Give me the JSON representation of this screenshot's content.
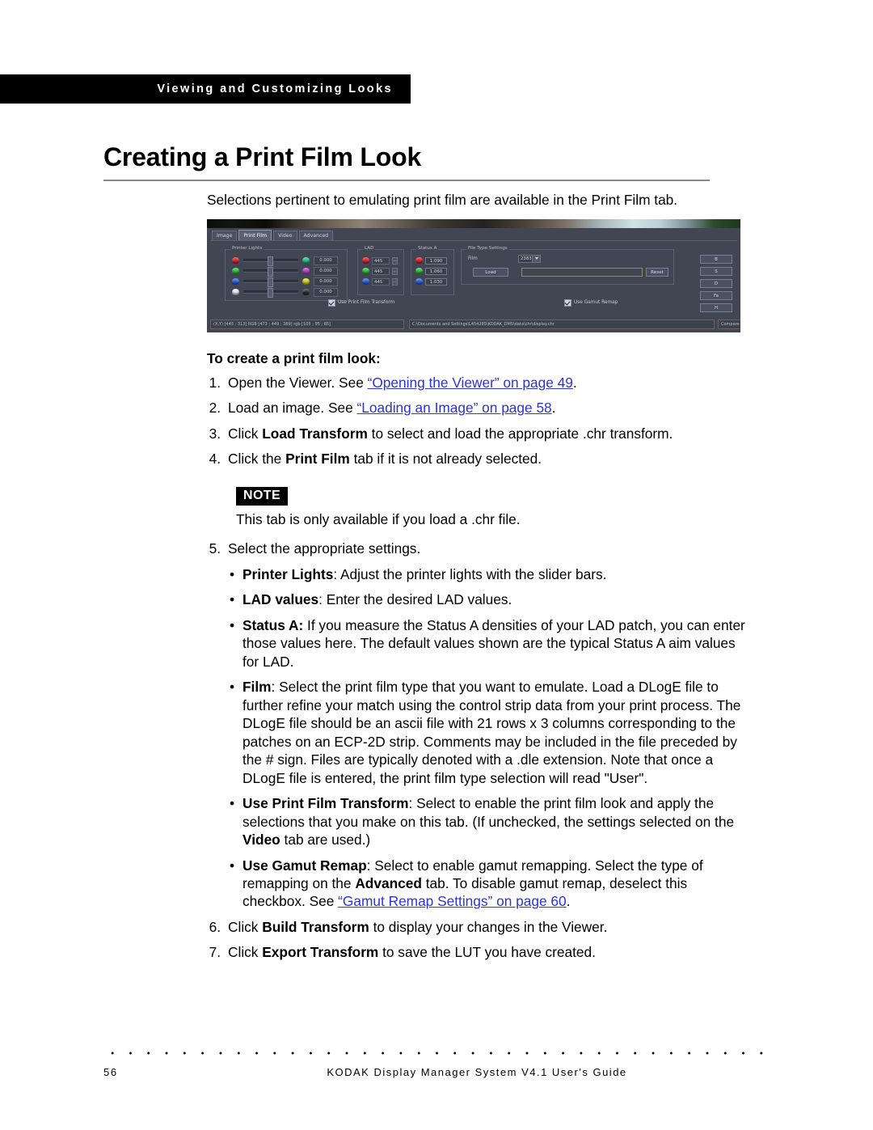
{
  "running_header": "Viewing and Customizing Looks",
  "page_title": "Creating a Print Film Look",
  "intro_paragraph": "Selections pertinent to emulating print film are available in the Print Film tab.",
  "screenshot": {
    "tabs": [
      {
        "label": "Image",
        "active": false
      },
      {
        "label": "Print Film",
        "active": true
      },
      {
        "label": "Video",
        "active": false
      },
      {
        "label": "Advanced",
        "active": false
      }
    ],
    "printer_lights": {
      "group_label": "Printer Lights",
      "rows": [
        {
          "left_color": "#e0202c",
          "right_color": "#25c28a",
          "value": "0.000",
          "thumb_pct": 44
        },
        {
          "left_color": "#2bc43a",
          "right_color": "#b53fd8",
          "value": "0.000",
          "thumb_pct": 44
        },
        {
          "left_color": "#2b5fe0",
          "right_color": "#d8d028",
          "value": "0.000",
          "thumb_pct": 44
        },
        {
          "left_color": "#e8eaf0",
          "right_color": "#2a2e36",
          "value": "0.000",
          "thumb_pct": 44
        }
      ]
    },
    "lad": {
      "group_label": "LAD",
      "rows": [
        {
          "color": "#e0202c",
          "value": "445"
        },
        {
          "color": "#2bc43a",
          "value": "445"
        },
        {
          "color": "#2b5fe0",
          "value": "445"
        }
      ]
    },
    "status_a": {
      "group_label": "Status A",
      "rows": [
        {
          "color": "#e0202c",
          "value": "1.090"
        },
        {
          "color": "#2bc43a",
          "value": "1.060"
        },
        {
          "color": "#2b5fe0",
          "value": "1.030"
        }
      ]
    },
    "film_type_settings": {
      "group_label": "File Type Settings",
      "film_label": "Film",
      "film_value": "2383",
      "load_button": "Load",
      "path_value": "",
      "reset_button": "Reset"
    },
    "checkboxes": [
      {
        "label": "Use Print Film Transform",
        "checked": true
      },
      {
        "label": "Use Gamut Remap",
        "checked": true
      }
    ],
    "right_buttons": [
      "B",
      "S",
      "D",
      "Fa",
      "H"
    ],
    "status_bar": {
      "coords": "(X,Y) [445 ; 313]  RGB [473 ; 449 ; 389]  rgb [105 ; 95 ; 85]",
      "path": "C:\\Documents and Settings\\L454285\\KODAK_DMS\\data\\chr\\display.chr",
      "compare": "Compare"
    }
  },
  "procedure": {
    "heading": "To create a print film look:",
    "steps": [
      {
        "num": "1.",
        "parts": [
          {
            "t": "Open the Viewer. See "
          },
          {
            "t": "“Opening the Viewer” on page 49",
            "style": "link"
          },
          {
            "t": "."
          }
        ]
      },
      {
        "num": "2.",
        "parts": [
          {
            "t": "Load an image. See "
          },
          {
            "t": "“Loading an Image” on page 58",
            "style": "link"
          },
          {
            "t": "."
          }
        ]
      },
      {
        "num": "3.",
        "parts": [
          {
            "t": "Click "
          },
          {
            "t": "Load Transform",
            "style": "bold"
          },
          {
            "t": " to select and load the appropriate .chr transform."
          }
        ]
      },
      {
        "num": "4.",
        "parts": [
          {
            "t": "Click the "
          },
          {
            "t": "Print Film",
            "style": "bold"
          },
          {
            "t": " tab if it is not already selected."
          }
        ]
      }
    ],
    "note": {
      "badge": "NOTE",
      "text": "This tab is only available if you load a .chr file."
    },
    "step5": {
      "num": "5.",
      "text": "Select the appropriate settings."
    },
    "bullets": [
      {
        "parts": [
          {
            "t": "Printer Lights",
            "style": "bold"
          },
          {
            "t": ": Adjust the printer lights with the slider bars."
          }
        ]
      },
      {
        "parts": [
          {
            "t": "LAD values",
            "style": "bold"
          },
          {
            "t": ": Enter the desired LAD values."
          }
        ]
      },
      {
        "parts": [
          {
            "t": "Status A:",
            "style": "bold"
          },
          {
            "t": " If you measure the Status A densities of your LAD patch, you can enter those values here. The default values shown are the typical Status A aim values for LAD."
          }
        ]
      },
      {
        "parts": [
          {
            "t": "Film",
            "style": "bold"
          },
          {
            "t": ": Select the print film type that you want to emulate.  Load a DLogE file to further refine your match using the control strip data from your print process.  The DLogE file should be an ascii file with 21 rows x 3 columns corresponding to the patches on an ECP-2D strip.  Comments may be included in the file preceded by the # sign.  Files are typically denoted with a .dle extension.  Note that once a DLogE file is entered, the print film type selection will read \"User\"."
          }
        ]
      },
      {
        "parts": [
          {
            "t": "Use Print Film Transform",
            "style": "bold"
          },
          {
            "t": ": Select to enable the print film look and apply the selections that you make on this tab. (If unchecked, the settings selected on the "
          },
          {
            "t": "Video",
            "style": "bold"
          },
          {
            "t": " tab are used.)"
          }
        ]
      },
      {
        "parts": [
          {
            "t": "Use Gamut Remap",
            "style": "bold"
          },
          {
            "t": ": Select to enable gamut remapping. Select the type of remapping on the "
          },
          {
            "t": "Advanced",
            "style": "bold"
          },
          {
            "t": " tab. To disable gamut remap, deselect this checkbox. See "
          },
          {
            "t": "“Gamut Remap Settings” on page 60",
            "style": "link"
          },
          {
            "t": "."
          }
        ]
      }
    ],
    "steps_tail": [
      {
        "num": "6.",
        "parts": [
          {
            "t": "Click "
          },
          {
            "t": "Build Transform",
            "style": "bold"
          },
          {
            "t": " to display your changes in the Viewer."
          }
        ]
      },
      {
        "num": "7.",
        "parts": [
          {
            "t": "Click "
          },
          {
            "t": "Export Transform",
            "style": "bold"
          },
          {
            "t": " to save the LUT you have created."
          }
        ]
      }
    ]
  },
  "footer": {
    "page_number": "56",
    "doc_title": "KODAK Display Manager System V4.1 User's Guide"
  }
}
